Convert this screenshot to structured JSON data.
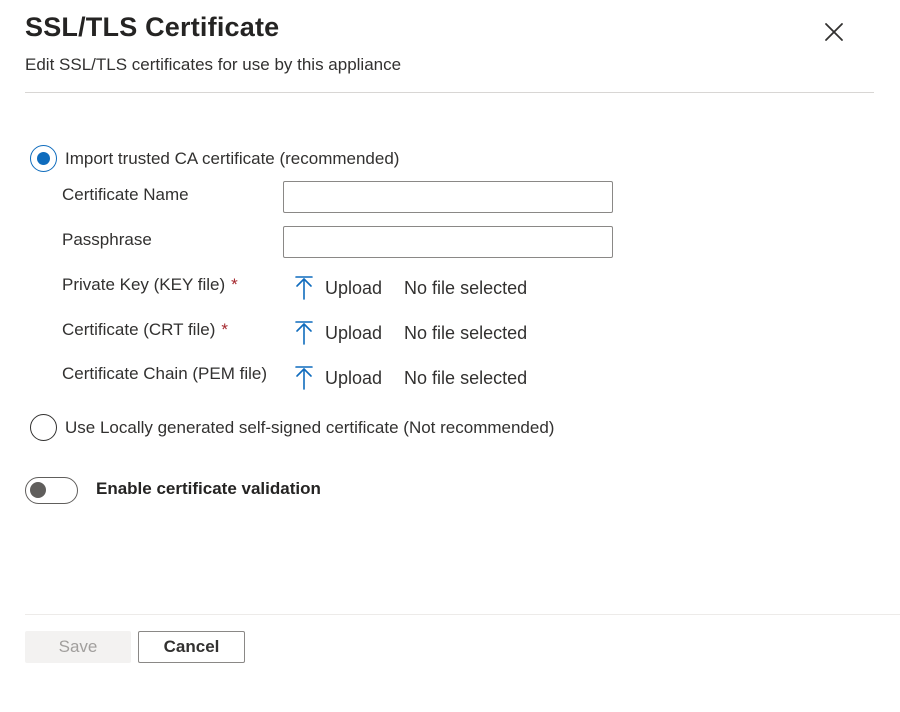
{
  "header": {
    "title": "SSL/TLS Certificate",
    "subtitle": "Edit SSL/TLS certificates for use by this appliance",
    "close_icon": "close-icon"
  },
  "options": {
    "import": {
      "label": "Import trusted CA certificate (recommended)",
      "selected": true
    },
    "self_signed": {
      "label": "Use Locally generated self-signed certificate (Not recommended)",
      "selected": false
    }
  },
  "fields": {
    "certificate_name": {
      "label": "Certificate Name",
      "value": "",
      "placeholder": ""
    },
    "passphrase": {
      "label": "Passphrase",
      "value": "",
      "placeholder": ""
    }
  },
  "uploads": [
    {
      "label": "Private Key (KEY file)",
      "required": "*",
      "button": "Upload",
      "status": "No file selected"
    },
    {
      "label": "Certificate (CRT file)",
      "required": "*",
      "button": "Upload",
      "status": "No file selected"
    },
    {
      "label": "Certificate Chain (PEM file)",
      "required": "",
      "button": "Upload",
      "status": "No file selected"
    }
  ],
  "validation_toggle": {
    "label": "Enable certificate validation",
    "enabled": false
  },
  "footer": {
    "save_label": "Save",
    "cancel_label": "Cancel"
  },
  "colors": {
    "accent": "#0f6cbd",
    "required": "#a4262c",
    "disabled_text": "#a19f9d"
  }
}
